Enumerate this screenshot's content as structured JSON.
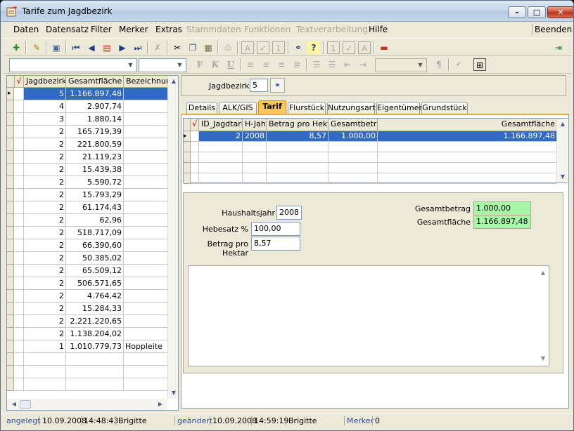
{
  "window": {
    "title": "Tarife zum Jagdbezirk"
  },
  "menu": {
    "items": [
      {
        "label": "Daten",
        "enabled": true
      },
      {
        "label": "Datensatz",
        "enabled": true
      },
      {
        "label": "Filter",
        "enabled": true
      },
      {
        "label": "Merker",
        "enabled": true
      },
      {
        "label": "Extras",
        "enabled": true
      },
      {
        "label": "Stammdaten",
        "enabled": false
      },
      {
        "label": "Funktionen",
        "enabled": false
      },
      {
        "label": "Textverarbeitung",
        "enabled": false
      },
      {
        "label": "Hilfe",
        "enabled": true
      }
    ],
    "right": "Beenden"
  },
  "toolbar2": {
    "bold": "F",
    "italic": "K",
    "underline": "U",
    "para": "¶"
  },
  "leftgrid": {
    "headers": [
      "√",
      "Jagdbezirk",
      "Gesamtfläche",
      "Bezeichnung"
    ],
    "rows": [
      {
        "jagdbezirk": "5",
        "flaeche": "1.166.897,48",
        "bez": ""
      },
      {
        "jagdbezirk": "4",
        "flaeche": "2.907,74",
        "bez": ""
      },
      {
        "jagdbezirk": "3",
        "flaeche": "1.880,14",
        "bez": ""
      },
      {
        "jagdbezirk": "2",
        "flaeche": "165.719,39",
        "bez": ""
      },
      {
        "jagdbezirk": "2",
        "flaeche": "221.800,59",
        "bez": ""
      },
      {
        "jagdbezirk": "2",
        "flaeche": "21.119,23",
        "bez": ""
      },
      {
        "jagdbezirk": "2",
        "flaeche": "15.439,38",
        "bez": ""
      },
      {
        "jagdbezirk": "2",
        "flaeche": "5.590,72",
        "bez": ""
      },
      {
        "jagdbezirk": "2",
        "flaeche": "15.793,29",
        "bez": ""
      },
      {
        "jagdbezirk": "2",
        "flaeche": "61.174,43",
        "bez": ""
      },
      {
        "jagdbezirk": "2",
        "flaeche": "62,96",
        "bez": ""
      },
      {
        "jagdbezirk": "2",
        "flaeche": "518.717,09",
        "bez": ""
      },
      {
        "jagdbezirk": "2",
        "flaeche": "66.390,60",
        "bez": ""
      },
      {
        "jagdbezirk": "2",
        "flaeche": "50.385,02",
        "bez": ""
      },
      {
        "jagdbezirk": "2",
        "flaeche": "65.509,12",
        "bez": ""
      },
      {
        "jagdbezirk": "2",
        "flaeche": "506.571,65",
        "bez": ""
      },
      {
        "jagdbezirk": "2",
        "flaeche": "4.764,42",
        "bez": ""
      },
      {
        "jagdbezirk": "2",
        "flaeche": "15.284,33",
        "bez": ""
      },
      {
        "jagdbezirk": "2",
        "flaeche": "2.221.220,65",
        "bez": ""
      },
      {
        "jagdbezirk": "2",
        "flaeche": "1.138.204,02",
        "bez": ""
      },
      {
        "jagdbezirk": "1",
        "flaeche": "1.010.779,73",
        "bez": "Hoppleite"
      }
    ]
  },
  "jagdbezirk": {
    "label": "Jagdbezirk",
    "value": "5"
  },
  "tabs": [
    {
      "label": "Details",
      "active": false
    },
    {
      "label": "ALK/GIS",
      "active": false
    },
    {
      "label": "Tarif",
      "active": true
    },
    {
      "label": "Flurstück",
      "active": false
    },
    {
      "label": "Nutzungsart",
      "active": false
    },
    {
      "label": "Eigentümer",
      "active": false
    },
    {
      "label": "Grundstück",
      "active": false
    }
  ],
  "tarifgrid": {
    "headers": [
      "√",
      "ID_Jagdtarif",
      "H-Jahr",
      "Betrag pro Hektar",
      "Gesamtbetrag",
      "Gesamtfläche"
    ],
    "rows": [
      {
        "id": "2",
        "jahr": "2008",
        "betrag": "8,57",
        "gesamt": "1.000,00",
        "flaeche": "1.166.897,48"
      }
    ]
  },
  "form": {
    "haushaltsjahr_label": "Haushaltsjahr",
    "haushaltsjahr": "2008",
    "hebesatz_label": "Hebesatz %",
    "hebesatz": "100,00",
    "betrag_label": "Betrag pro Hektar",
    "betrag": "8,57",
    "gesamtbetrag_label": "Gesamtbetrag",
    "gesamtbetrag": "1.000,00",
    "gesamtflaeche_label": "Gesamtfläche",
    "gesamtflaeche": "1.166.897,48"
  },
  "status": {
    "angelegt_label": "angelegt",
    "angelegt_date": "10.09.2008",
    "angelegt_time": "14:48:43",
    "angelegt_user": "Brigitte",
    "geaendert_label": "geändert",
    "geaendert_date": "10.09.2008",
    "geaendert_time": "14:59:19",
    "geaendert_user": "Brigitte",
    "merker_label": "Merker",
    "merker_value": "0"
  }
}
